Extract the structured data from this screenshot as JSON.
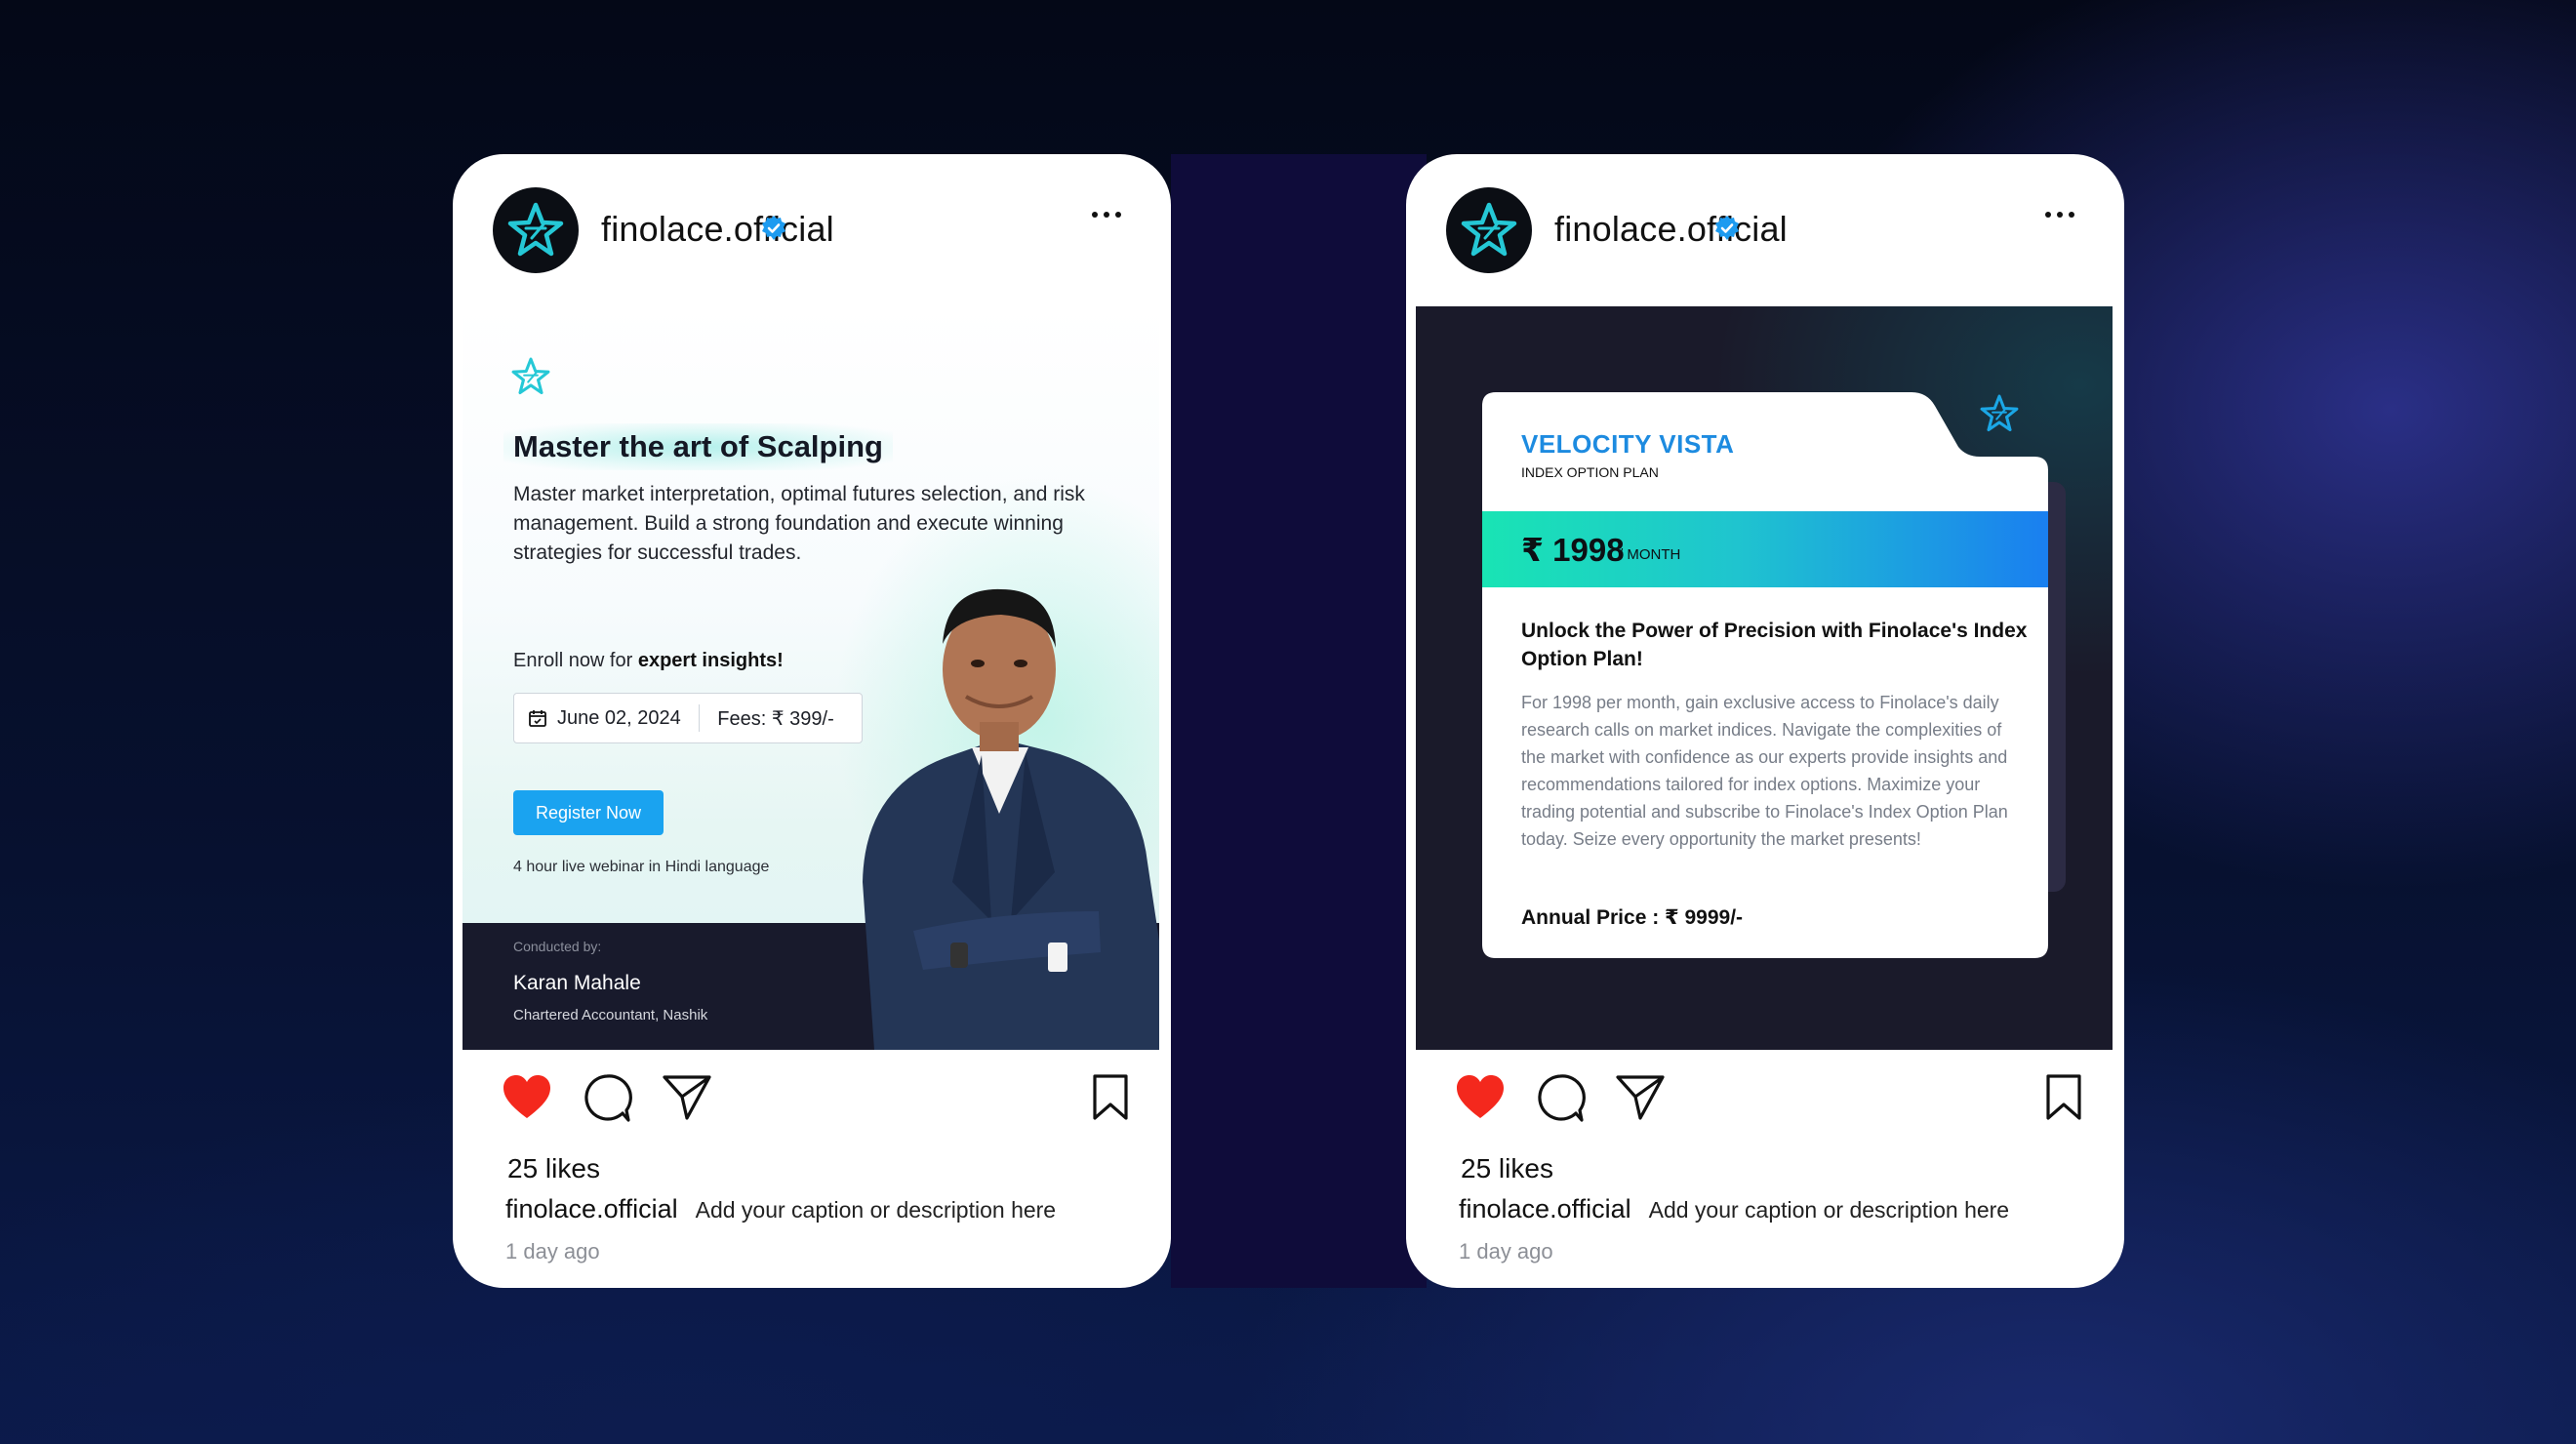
{
  "posts": [
    {
      "account": {
        "handle": "finolace.official",
        "verified": true
      },
      "content": {
        "title": "Master the art of Scalping",
        "description": "Master market interpretation, optimal futures selection, and risk management. Build a strong foundation and execute winning strategies for successful trades.",
        "enroll_prefix": "Enroll now for ",
        "enroll_bold": "expert insights!",
        "date": "June 02, 2024",
        "fees": "Fees: ₹ 399/-",
        "cta": "Register Now",
        "note": "4 hour live  webinar in Hindi language",
        "conducted_by_label": "Conducted by:",
        "presenter_name": "Karan Mahale",
        "presenter_role": "Chartered Accountant, Nashik"
      },
      "likes": "25 likes",
      "caption_user": "finolace.official",
      "caption": "Add your caption or description here",
      "time": "1 day ago"
    },
    {
      "account": {
        "handle": "finolace.official",
        "verified": true
      },
      "content": {
        "plan_name": "VELOCITY VISTA",
        "plan_sub": "INDEX OPTION PLAN",
        "price": "₹ 1998",
        "per": "/ MONTH",
        "headline": "Unlock the Power of Precision with Finolace's Index Option Plan!",
        "body": "For 1998 per month, gain exclusive access to Finolace's daily research calls on market indices. Navigate the complexities of the market with confidence as our experts provide insights and recommendations tailored for index options. Maximize your trading potential and subscribe to Finolace's Index Option Plan today. Seize every opportunity the market presents!",
        "annual": "Annual Price : ₹ 9999/-"
      },
      "likes": "25 likes",
      "caption_user": "finolace.official",
      "caption": "Add your caption or description here",
      "time": "1 day ago"
    }
  ],
  "colors": {
    "accent_teal": "#19e4b4",
    "accent_blue": "#1aa3f0",
    "heart_red": "#f4281d",
    "verified_blue": "#1d9bf0"
  },
  "icons": [
    "star-logo-icon",
    "verified-badge-icon",
    "more-icon",
    "heart-icon",
    "comment-icon",
    "share-icon",
    "bookmark-icon",
    "calendar-icon"
  ]
}
